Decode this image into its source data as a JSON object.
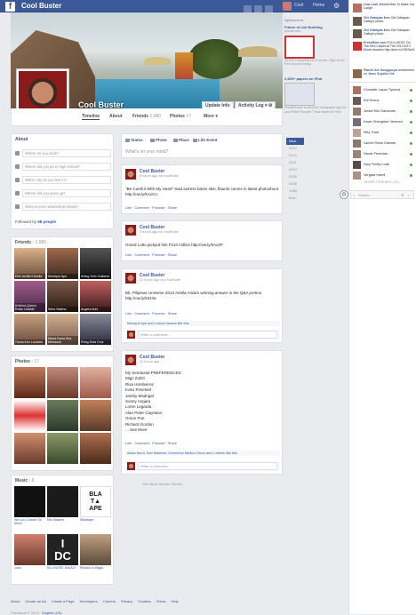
{
  "app": {
    "name": "Cool Buster"
  },
  "topbar": {
    "user": "Cool",
    "home": "Home"
  },
  "profile": {
    "name": "Cool Buster",
    "update_info": "Update Info",
    "activity_log": "Activity Log"
  },
  "nav": {
    "tabs": [
      {
        "label": "Timeline"
      },
      {
        "label": "About"
      },
      {
        "label": "Friends",
        "count": "1,980"
      },
      {
        "label": "Photos",
        "count": "17"
      },
      {
        "label": "More"
      }
    ]
  },
  "sponsored": {
    "label": "Sponsored",
    "ads": [
      {
        "title": "Future of List Building",
        "site": "jsbook.com",
        "text": "10,000 subscribers in 6 weeks. Sign up for free account today."
      },
      {
        "title": "2,300+ papers on iPad",
        "site": "",
        "text": "PressReader is the killer newspaper app for your iPad! Receive 7 trial issues for free."
      }
    ]
  },
  "years": [
    "Now",
    "2013",
    "2012",
    "2011",
    "2010",
    "2009",
    "2008",
    "1985",
    "Born"
  ],
  "about": {
    "title": "About",
    "rows": [
      "Where do you work?",
      "Where did you go to high school?",
      "Which city do you live in?",
      "Where did you grow up?",
      "What is your relationship status?"
    ],
    "followed_label": "Followed by",
    "followed_count": "68 people"
  },
  "friends": {
    "title": "Friends",
    "count": "1,980",
    "items": [
      "Ellie Arcilla Estrella",
      "Monique Apo",
      "Arting Sofu Gallardo",
      "Krishna Quezo Rosin Ubalde",
      "Wela Sabina",
      "Angela Arini",
      "Gloria Ann Laudaro",
      "Maria Fania Sira Mendoza",
      "Rheg Dela Cruz"
    ]
  },
  "photos": {
    "title": "Photos",
    "count": "17"
  },
  "music": {
    "title": "Music",
    "count": "6",
    "items": [
      "We Luv Chance So Much",
      "Mix Masters",
      "Starktape",
      "Juno",
      "KILLINGEE DAVAO",
      "Pandoo in Bilgar"
    ]
  },
  "composer": {
    "tabs": [
      "Status",
      "Photo",
      "Place",
      "Life Event"
    ],
    "placeholder": "What's on your mind?"
  },
  "posts": [
    {
      "name": "Cool Buster",
      "time": "8 hours ago via HootSuite",
      "text": "\"Be Careful With My Heart\" lead actress bares skin, flaunts curves in latest photoshoot http://ow.ly/kAxCU",
      "actions": "Like · Comment · Promote · Share"
    },
    {
      "name": "Cool Buster",
      "time": "9 hours ago via HootSuite",
      "text": "Grand Lotto jackpot hits P110 million http://ow.ly/kAx2P",
      "actions": "Like · Comment · Promote · Share"
    },
    {
      "name": "Cool Buster",
      "time": "22 hours ago via HootSuite",
      "text": "Bb. Pilipinas Universe 2013 Ariella Arida's winning answer in the Q&A portion http://ow.ly/k3z3a",
      "actions": "Like · Comment · Promote · Share",
      "likes": "Monique Apo and Lorena Javana like this.",
      "comment_placeholder": "Write a comment..."
    },
    {
      "name": "Cool Buster",
      "time": "23 hours ago",
      "text": "My Senatorial PREFERENCES:\nMigz Zubiri\nRisa Hontiveros\nKoko Pimentel\nJamby Madrigal\nSonny Angara\nLoren Legarda\nAlan Peter Cayetano\nGrace Poe\nRichard Gordon\n... See More",
      "actions": "Like · Comment · Promote · Share",
      "likes": "Aidan Karol, Drei Martinez, Cheverine Medico Dizon and 2 others like this.",
      "comment_placeholder": "Write a comment..."
    }
  ],
  "see_more": "See More Recent Stories",
  "ticker": [
    {
      "name": "Lisa Leah Jeremi",
      "text": "likes To Make You Laugh."
    },
    {
      "name": "Ziel Gabayan",
      "text": "likes Ziel Gabayan Galing's photo."
    },
    {
      "name": "Ziel Gabayan",
      "text": "likes Ziel Gabayan Galing's photo."
    },
    {
      "name": "PressWire.com",
      "text": "EXCLUSIVE! On The Red Carpet At The 2013 MTV Movie Awards! http://pero.lc/1fDSzn9"
    },
    {
      "name": "Plaech Are Songqueya",
      "text": "commented on Jesus Sugala's link."
    }
  ],
  "chat": {
    "contacts": [
      "Conradie Lapuz Tiponza",
      "Edi Duenz",
      "Jessel Elin Gardones",
      "Kaver Shenglicie Vermont",
      "Kitty Trixie",
      "Lachie Ruelo Damian",
      "Nicole Fenecias",
      "Sary Thrifty Lovik",
      "Vergara Harell"
    ],
    "more_friends": "MORE FRIENDS (47)",
    "search_placeholder": "Search"
  },
  "footer": {
    "links": [
      "About",
      "Create an Ad",
      "Create a Page",
      "Developers",
      "Careers",
      "Privacy",
      "Cookies",
      "Terms",
      "Help"
    ],
    "copyright": "Facebook © 2013 ·",
    "language": "English (US)"
  }
}
